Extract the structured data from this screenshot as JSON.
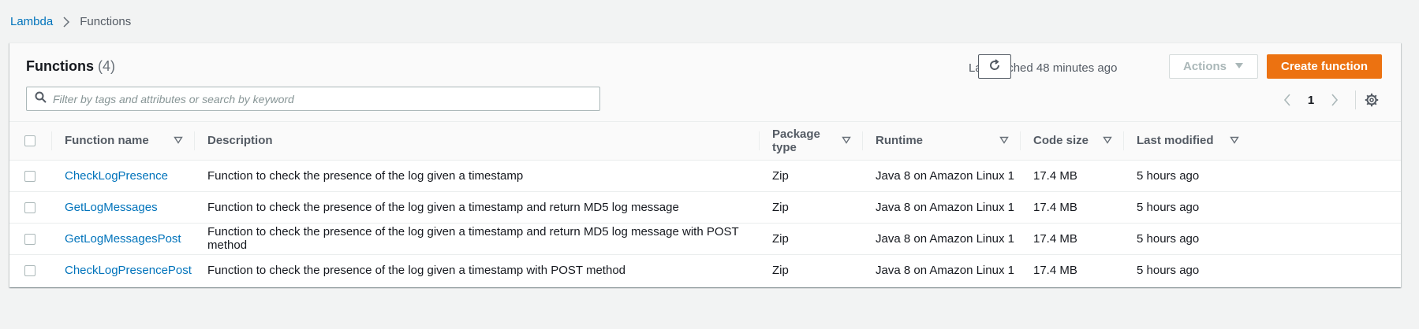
{
  "breadcrumb": {
    "root": "Lambda",
    "current": "Functions"
  },
  "header": {
    "title": "Functions",
    "count": "(4)",
    "last_fetched": "Last fetched 48 minutes ago",
    "actions_label": "Actions",
    "create_label": "Create function",
    "search_placeholder": "Filter by tags and attributes or search by keyword",
    "page": "1"
  },
  "table": {
    "columns": {
      "name": "Function name",
      "description": "Description",
      "package_type": "Package type",
      "runtime": "Runtime",
      "code_size": "Code size",
      "last_modified": "Last modified"
    },
    "rows": [
      {
        "name": "CheckLogPresence",
        "description": "Function to check the presence of the log given a timestamp",
        "package_type": "Zip",
        "runtime": "Java 8 on Amazon Linux 1",
        "code_size": "17.4 MB",
        "last_modified": "5 hours ago"
      },
      {
        "name": "GetLogMessages",
        "description": "Function to check the presence of the log given a timestamp and return MD5 log message",
        "package_type": "Zip",
        "runtime": "Java 8 on Amazon Linux 1",
        "code_size": "17.4 MB",
        "last_modified": "5 hours ago"
      },
      {
        "name": "GetLogMessagesPost",
        "description": "Function to check the presence of the log given a timestamp and return MD5 log message with POST method",
        "package_type": "Zip",
        "runtime": "Java 8 on Amazon Linux 1",
        "code_size": "17.4 MB",
        "last_modified": "5 hours ago"
      },
      {
        "name": "CheckLogPresencePost",
        "description": "Function to check the presence of the log given a timestamp with POST method",
        "package_type": "Zip",
        "runtime": "Java 8 on Amazon Linux 1",
        "code_size": "17.4 MB",
        "last_modified": "5 hours ago"
      }
    ]
  },
  "colors": {
    "link": "#0073bb",
    "primary": "#ec7211",
    "background": "#f2f3f3"
  },
  "icons": [
    "chevron-right-icon",
    "refresh-icon",
    "caret-down-icon",
    "search-icon",
    "chevron-left-icon",
    "settings-icon",
    "sort-icon"
  ]
}
